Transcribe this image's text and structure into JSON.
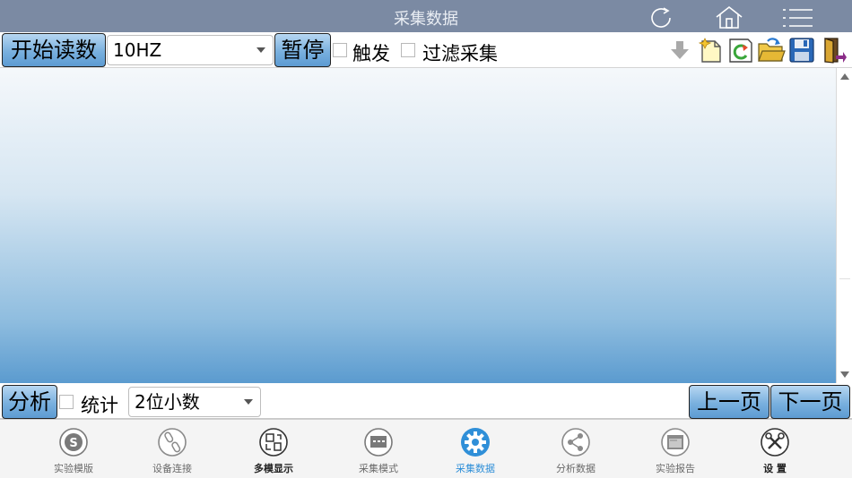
{
  "header": {
    "title": "采集数据",
    "icons": [
      "refresh-icon",
      "home-icon",
      "menu-icon"
    ]
  },
  "toolbar": {
    "start_label": "开始读数",
    "rate": {
      "selected": "10HZ",
      "options": [
        "10HZ"
      ]
    },
    "pause_label": "暂停",
    "trigger": {
      "label": "触发",
      "checked": false
    },
    "filter": {
      "label": "过滤采集",
      "checked": false
    },
    "icons": [
      "download-arrow-icon",
      "new-file-icon",
      "reload-icon",
      "open-folder-icon",
      "save-disk-icon",
      "exit-door-icon"
    ]
  },
  "bottom": {
    "analyze_label": "分析",
    "stats": {
      "label": "统计",
      "checked": false
    },
    "decimals": {
      "selected": "2位小数",
      "options": [
        "2位小数"
      ]
    },
    "prev_label": "上一页",
    "next_label": "下一页"
  },
  "tabs": [
    {
      "label": "实验模版",
      "icon": "template-icon",
      "state": "normal"
    },
    {
      "label": "设备连接",
      "icon": "link-icon",
      "state": "normal"
    },
    {
      "label": "多模显示",
      "icon": "multi-display-icon",
      "state": "bold"
    },
    {
      "label": "采集模式",
      "icon": "mode-icon",
      "state": "normal"
    },
    {
      "label": "采集数据",
      "icon": "gear-icon",
      "state": "active"
    },
    {
      "label": "分析数据",
      "icon": "share-icon",
      "state": "normal"
    },
    {
      "label": "实验报告",
      "icon": "report-icon",
      "state": "normal"
    },
    {
      "label": "设 置",
      "icon": "tools-icon",
      "state": "bold"
    }
  ],
  "colors": {
    "titlebar": "#7b8aa3",
    "button": "#79b0de",
    "active_tab": "#2f8fd8"
  }
}
